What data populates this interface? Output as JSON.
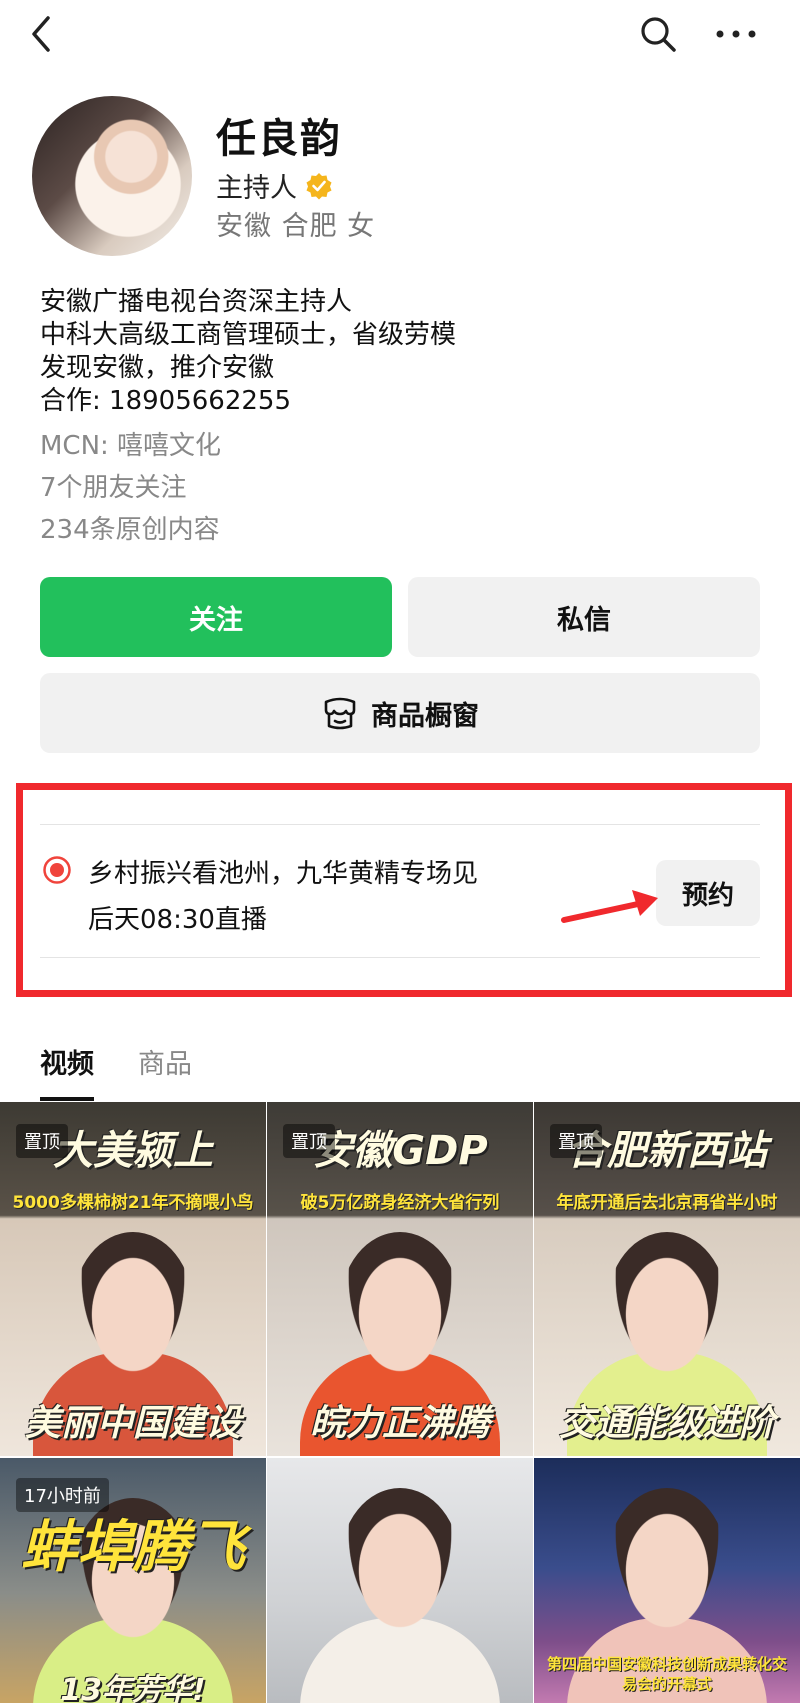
{
  "profile": {
    "name": "任良韵",
    "role": "主持人",
    "location": "安徽 合肥 女",
    "bio": [
      "安徽广播电视台资深主持人",
      "中科大高级工商管理硕士，省级劳模",
      "发现安徽，推介安徽",
      "合作: 18905662255"
    ],
    "mcn": "MCN: 嘻嘻文化",
    "friends": "7个朋友关注",
    "original": "234条原创内容"
  },
  "actions": {
    "follow": "关注",
    "message": "私信",
    "shop": "商品橱窗"
  },
  "live": {
    "title": "乡村振兴看池州，九华黄精专场见",
    "time": "后天08:30直播",
    "reserve": "预约"
  },
  "tabs": [
    "视频",
    "商品"
  ],
  "videos": [
    {
      "pin": "置顶",
      "headline": "大美颍上",
      "sub": "5000多棵柿树21年不摘喂小鸟",
      "caption": "美丽中国建设"
    },
    {
      "pin": "置顶",
      "headline": "安徽GDP",
      "sub": "破5万亿跻身经济大省行列",
      "caption": "皖力正沸腾"
    },
    {
      "pin": "置顶",
      "headline": "合肥新西站",
      "sub": "年底开通后去北京再省半小时",
      "caption": "交通能级进阶"
    },
    {
      "time": "17小时前",
      "headline": "蚌埠腾飞",
      "caption": "13年芳华!"
    },
    {
      "headline": ""
    },
    {
      "sub": "第四届中国安徽科技创新成果转化交易会的开幕式"
    }
  ],
  "colors": {
    "accent": "#22c05c",
    "highlight": "#f0292d",
    "verified": "#f5b51c"
  }
}
